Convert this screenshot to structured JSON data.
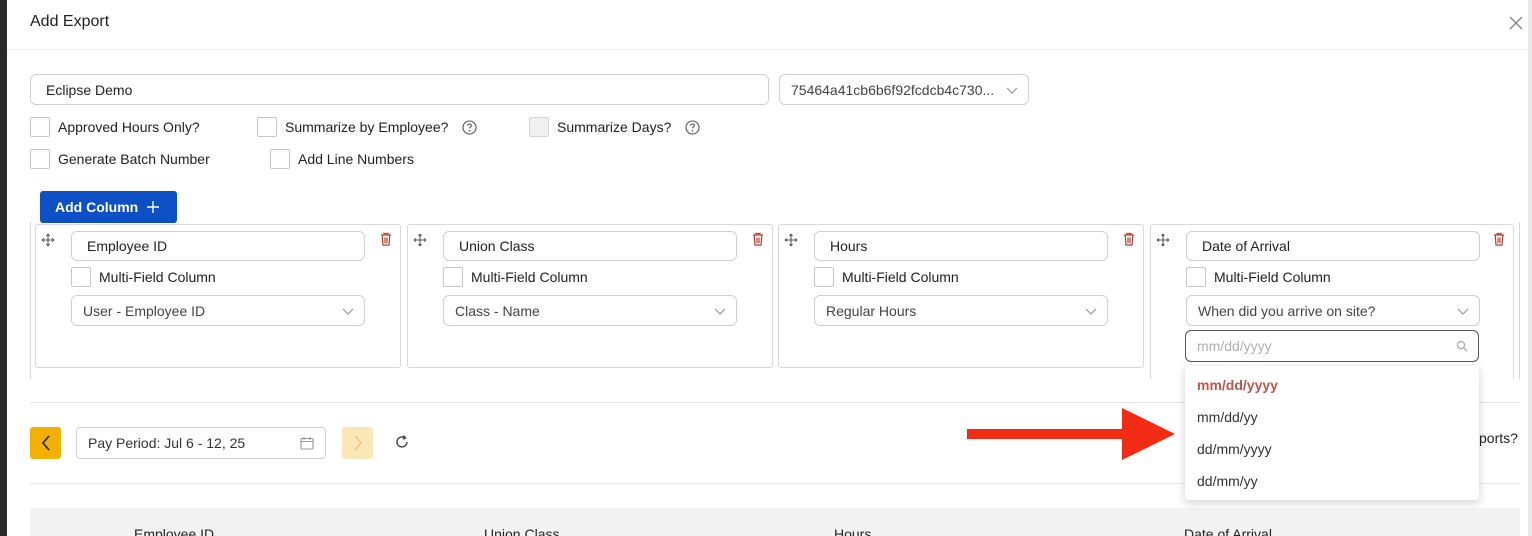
{
  "modal": {
    "title": "Add Export"
  },
  "form": {
    "export_name": "Eclipse Demo",
    "template_id": "75464a41cb6b6f92fcdcb4c730...",
    "options": {
      "approved_hours_only": "Approved Hours Only?",
      "summarize_by_employee": "Summarize by Employee?",
      "summarize_days": "Summarize Days?",
      "generate_batch_number": "Generate Batch Number",
      "add_line_numbers": "Add Line Numbers"
    }
  },
  "add_column_label": "Add Column",
  "columns": [
    {
      "name": "Employee ID",
      "multi_field_label": "Multi-Field Column",
      "source": "User - Employee ID"
    },
    {
      "name": "Union Class",
      "multi_field_label": "Multi-Field Column",
      "source": "Class - Name"
    },
    {
      "name": "Hours",
      "multi_field_label": "Multi-Field Column",
      "source": "Regular Hours"
    },
    {
      "name": "Date of Arrival",
      "multi_field_label": "Multi-Field Column",
      "source": "When did you arrive on site?",
      "format_placeholder": "mm/dd/yyyy"
    }
  ],
  "date_format_options": [
    "mm/dd/yyyy",
    "mm/dd/yy",
    "dd/mm/yyyy",
    "dd/mm/yy"
  ],
  "date_format_selected": "mm/dd/yyyy",
  "pay_period": "Pay Period: Jul 6 - 12, 25",
  "partial_label": "ports?",
  "preview_headers": [
    "Employee ID",
    "Union Class",
    "Hours",
    "Date of Arrival"
  ],
  "colors": {
    "primary": "#0d4fc4",
    "accent": "#f4b000",
    "danger": "#c0392b",
    "arrow": "#f22b14"
  }
}
